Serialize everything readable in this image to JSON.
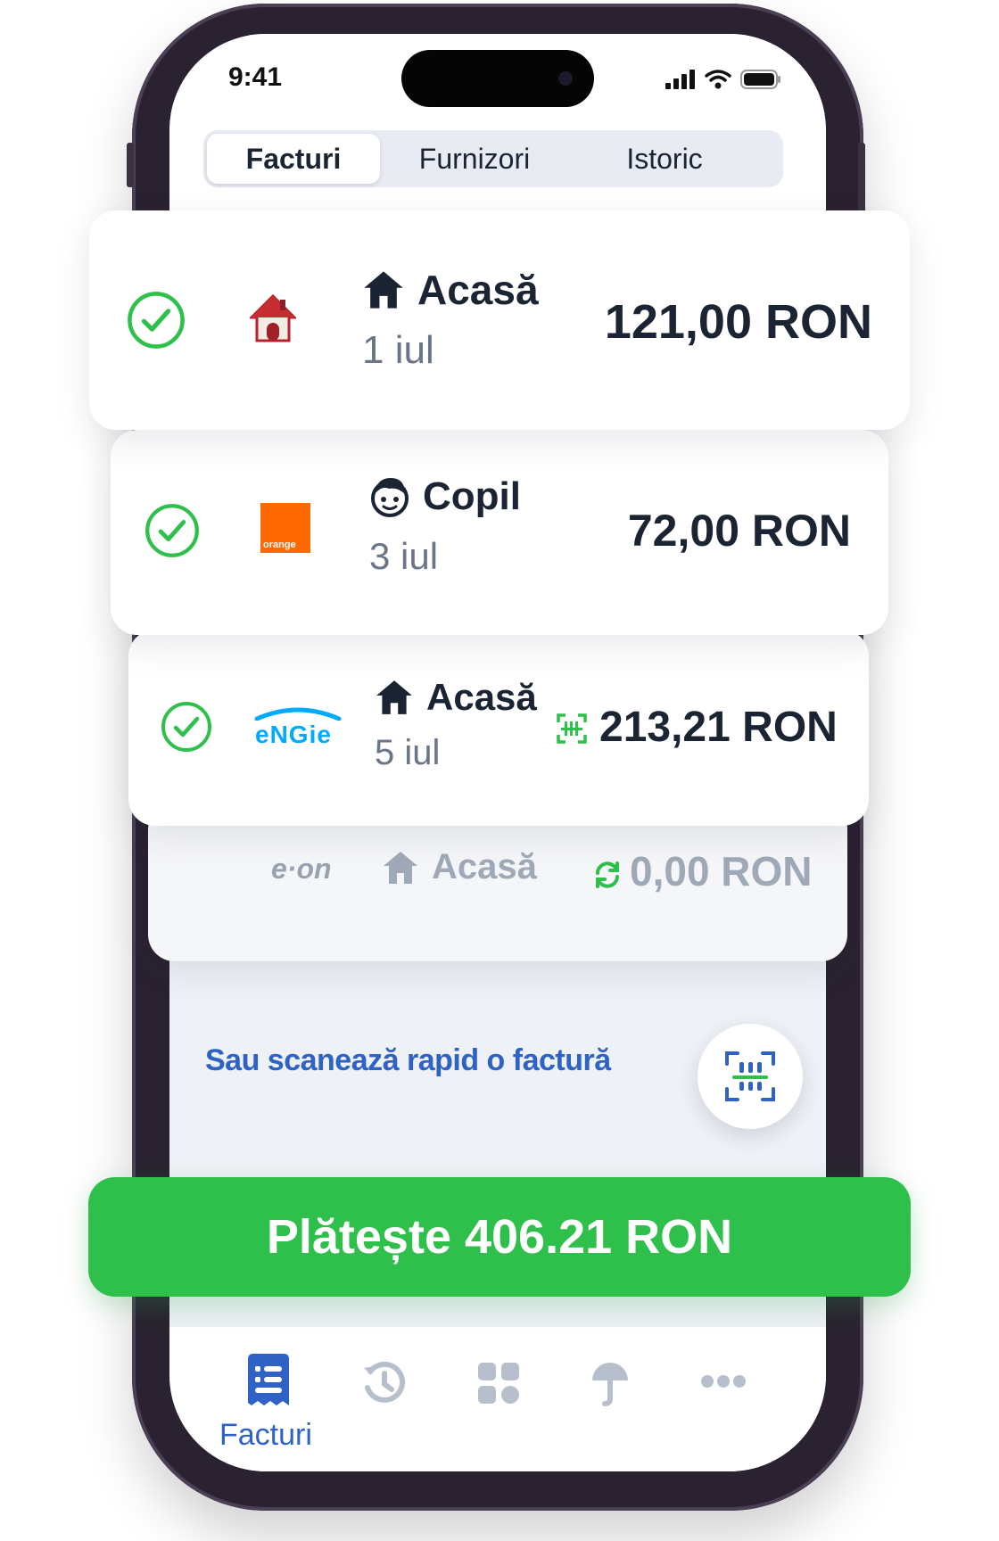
{
  "status_bar": {
    "time": "9:41"
  },
  "tabs": [
    {
      "label": "Facturi",
      "active": true
    },
    {
      "label": "Furnizori",
      "active": false
    },
    {
      "label": "Istoric",
      "active": false
    }
  ],
  "bills": [
    {
      "provider_icon": "house-icon",
      "category": "Acasă",
      "category_icon": "home-icon",
      "date": "1 iul",
      "amount": "121,00 RON",
      "checked": true
    },
    {
      "provider_icon": "orange-logo",
      "provider_logo_text": "orange",
      "category": "Copil",
      "category_icon": "child-icon",
      "date": "3 iul",
      "amount": "72,00 RON",
      "checked": true
    },
    {
      "provider_icon": "engie-logo",
      "provider_logo_text": "eNGie",
      "category": "Acasă",
      "category_icon": "home-icon",
      "date": "5 iul",
      "amount": "213,21 RON",
      "amount_icon": "barcode-scan-icon",
      "checked": true
    },
    {
      "provider_icon": "eon-logo",
      "provider_logo_text": "e·on",
      "category": "Acasă",
      "category_icon": "home-icon",
      "amount": "0,00 RON",
      "amount_icon": "refresh-icon",
      "checked": false
    }
  ],
  "scan": {
    "label": "Sau scanează rapid o factură"
  },
  "pay_button": {
    "label": "Plătește 406.21 RON"
  },
  "bottom_nav": {
    "items": [
      {
        "icon": "receipt-icon",
        "label": "Facturi",
        "active": true
      },
      {
        "icon": "history-icon"
      },
      {
        "icon": "grid-icon"
      },
      {
        "icon": "umbrella-icon"
      },
      {
        "icon": "more-icon"
      }
    ]
  },
  "colors": {
    "accent_green": "#2fc04c",
    "accent_blue": "#2e62c4",
    "text_dark": "#1b2433",
    "orange_brand": "#ff6a00",
    "engie_blue": "#00aaff"
  }
}
